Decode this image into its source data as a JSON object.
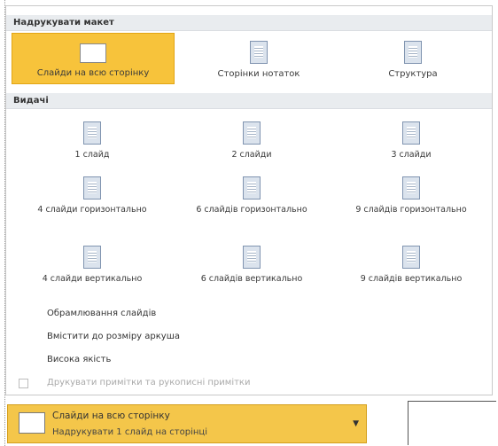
{
  "print_layout": {
    "header": "Надрукувати макет",
    "items": [
      {
        "label": "Слайди на всю сторінку",
        "icon": "slide-icon",
        "selected": true
      },
      {
        "label": "Сторінки нотаток",
        "icon": "notes-page-icon",
        "selected": false
      },
      {
        "label": "Структура",
        "icon": "outline-icon",
        "selected": false
      }
    ]
  },
  "handouts": {
    "header": "Видачі",
    "items": [
      {
        "label": "1 слайд",
        "icon": "handout-1-icon"
      },
      {
        "label": "2 слайди",
        "icon": "handout-2-icon"
      },
      {
        "label": "3 слайди",
        "icon": "handout-3-icon"
      },
      {
        "label": "4 слайди горизонтально",
        "icon": "handout-4h-icon"
      },
      {
        "label": "6 слайдів горизонтально",
        "icon": "handout-6h-icon"
      },
      {
        "label": "9 слайдів горизонтально",
        "icon": "handout-9h-icon"
      },
      {
        "label": "4 слайди вертикально",
        "icon": "handout-4v-icon"
      },
      {
        "label": "6 слайдів вертикально",
        "icon": "handout-6v-icon"
      },
      {
        "label": "9 слайдів вертикально",
        "icon": "handout-9v-icon"
      }
    ]
  },
  "options": [
    {
      "label": "Обрамлювання слайдів",
      "enabled": true
    },
    {
      "label": "Вмістити до розміру аркуша",
      "enabled": true
    },
    {
      "label": "Висока якість",
      "enabled": true
    },
    {
      "label": "Друкувати примітки та рукописні примітки",
      "enabled": false
    }
  ],
  "dropdown": {
    "title": "Слайди на всю сторінку",
    "subtitle": "Надрукувати 1 слайд на сторінці"
  },
  "colors": {
    "selected": "#f7c33b",
    "header_bg": "#e9ecef"
  }
}
